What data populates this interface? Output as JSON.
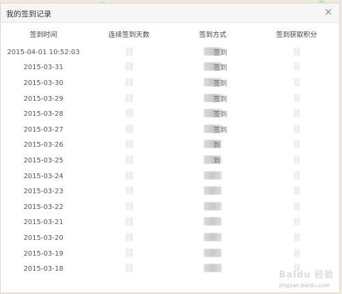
{
  "dialog": {
    "title": "我的签到记录",
    "close_glyph": "×"
  },
  "table": {
    "headers": [
      "签到时间",
      "连续签到天数",
      "签到方式",
      "签到获取积分"
    ],
    "rows": [
      {
        "time": "2015-04-01 10:52:03",
        "way": "签到"
      },
      {
        "time": "2015-03-31",
        "way": "签到"
      },
      {
        "time": "2015-03-30",
        "way": "签到"
      },
      {
        "time": "2015-03-29",
        "way": "签到"
      },
      {
        "time": "2015-03-28",
        "way": "签到"
      },
      {
        "time": "2015-03-27",
        "way": "签到"
      },
      {
        "time": "2015-03-26",
        "way": "到"
      },
      {
        "time": "2015-03-25",
        "way": "到"
      },
      {
        "time": "2015-03-24",
        "way": ""
      },
      {
        "time": "2015-03-23",
        "way": ""
      },
      {
        "time": "2015-03-22",
        "way": ""
      },
      {
        "time": "2015-03-21",
        "way": ""
      },
      {
        "time": "2015-03-20",
        "way": ""
      },
      {
        "time": "2015-03-19",
        "way": ""
      },
      {
        "time": "2015-03-18",
        "way": ""
      }
    ]
  },
  "watermark": {
    "brand": "Baidu 经验",
    "url": "jingyan.baidu.com"
  }
}
